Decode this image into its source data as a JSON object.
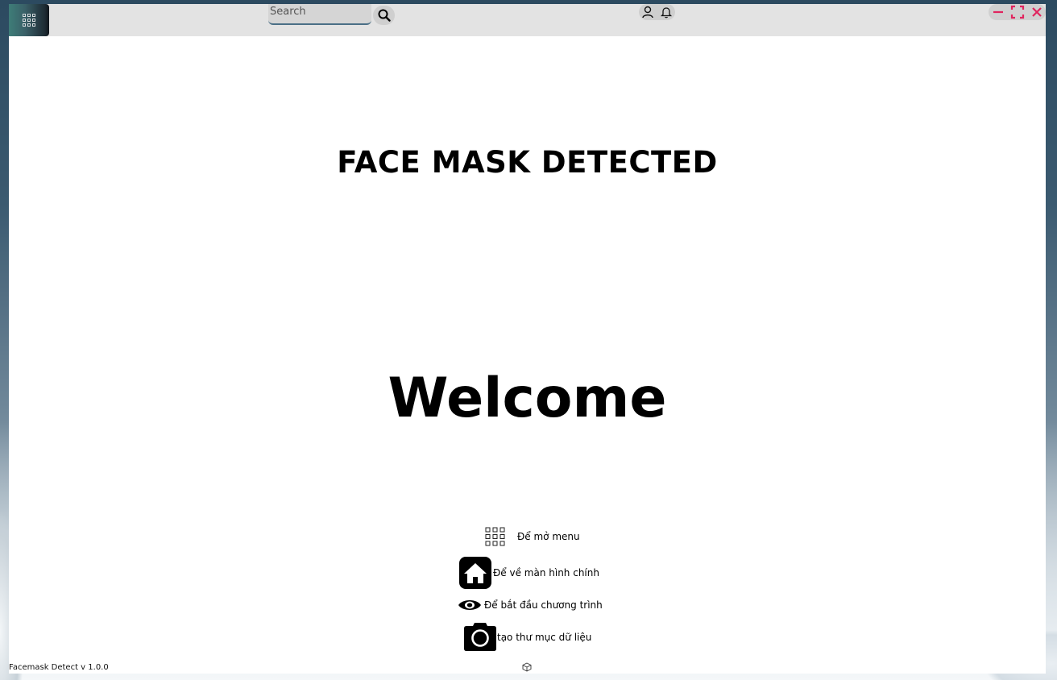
{
  "topbar": {
    "menu_icon": "grid-menu-icon",
    "search": {
      "placeholder": "Search",
      "value": ""
    },
    "user_icon": "user-icon",
    "bell_icon": "bell-icon",
    "window_controls": [
      "minimize-icon",
      "fullscreen-icon",
      "close-icon"
    ],
    "accent_color": "#e0245e"
  },
  "main": {
    "heading": "FACE MASK DETECTED",
    "welcome": "Welcome",
    "help": [
      {
        "icon": "grid-menu-icon",
        "text": "Để mở menu"
      },
      {
        "icon": "home-icon",
        "text": "Để về màn hình chính"
      },
      {
        "icon": "eye-icon",
        "text": "Để bắt đầu chương trình"
      },
      {
        "icon": "camera-icon",
        "text": "tạo thư mục dữ liệu"
      }
    ]
  },
  "footer": {
    "version": "Facemask Detect v 1.0.0",
    "icon": "cube-icon"
  }
}
